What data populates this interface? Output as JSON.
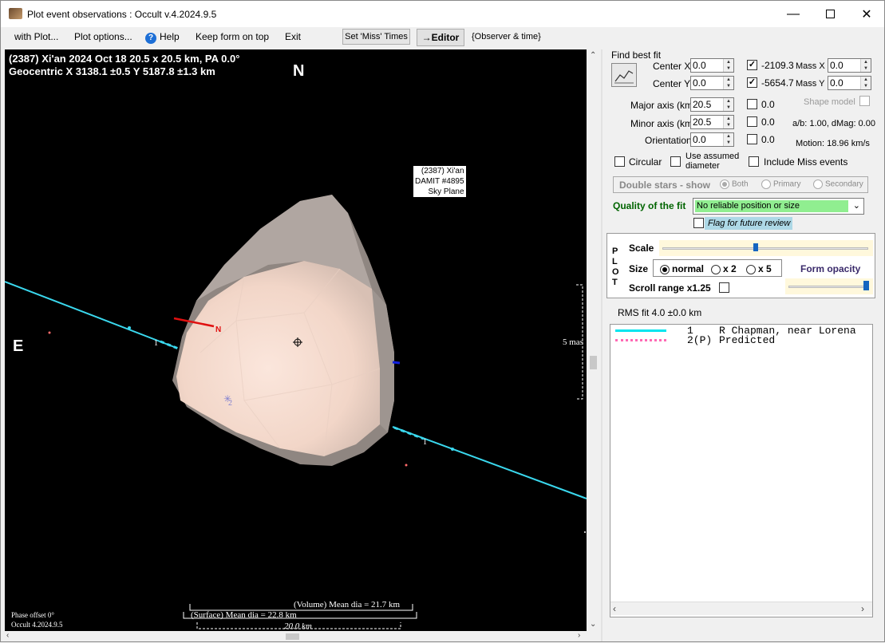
{
  "window": {
    "title": "Plot event observations : Occult v.4.2024.9.5"
  },
  "menu": {
    "with_plot": "with Plot...",
    "plot_options": "Plot options...",
    "help": "Help",
    "keep_form": "Keep form on top",
    "exit": "Exit",
    "set_miss_times": "Set 'Miss' Times",
    "editor": "→Editor",
    "observer_time": "{Observer & time}"
  },
  "plot": {
    "header_line1": "(2387) Xi'an  2024 Oct 18  20.5 x 20.5 km, PA 0.0°",
    "header_line2": "Geocentric  X  3138.1 ±0.5  Y 5187.8 ±1.3 km",
    "north": "N",
    "east": "E",
    "model_label_1": "(2387) Xi'an",
    "model_label_2": "DAMIT #4895",
    "model_label_3": "Sky Plane",
    "scale_label": "5 mas",
    "vol_dia": "(Volume) Mean dia = 21.7 km",
    "surf_dia": "(Surface) Mean dia = 22.8 km",
    "km_scale": "20.0 km",
    "phase_offset": "Phase offset 0°",
    "version": "Occult 4.2024.9.5",
    "chord_number": "1",
    "pole_label": "N",
    "predicted_number": "2"
  },
  "fit": {
    "find_best_fit": "Find best fit",
    "center_x_label": "Center X",
    "center_x": "0.0",
    "center_y_label": "Center Y",
    "center_y": "0.0",
    "x_value": "-2109.3",
    "y_value": "-5654.7",
    "mass_x_label": "Mass X",
    "mass_x": "0.0",
    "mass_y_label": "Mass Y",
    "mass_y": "0.0",
    "major_label": "Major axis (km)",
    "major": "20.5",
    "major_cb": "0.0",
    "minor_label": "Minor axis (km)",
    "minor": "20.5",
    "minor_cb": "0.0",
    "orient_label": "Orientation",
    "orient": "0.0",
    "orient_cb": "0.0",
    "shape_model": "Shape model",
    "ab_dmag": "a/b: 1.00, dMag: 0.00",
    "motion": "Motion: 18.96 km/s",
    "circular": "Circular",
    "use_assumed": "Use assumed",
    "diameter": "diameter",
    "include_miss": "Include Miss events",
    "double_stars": "Double stars - show",
    "both": "Both",
    "primary": "Primary",
    "secondary": "Secondary",
    "quality_label": "Quality of the fit",
    "quality_value": "No reliable position or size",
    "flag_review": "Flag for future review"
  },
  "plot_controls": {
    "p": "P",
    "l": "L",
    "o": "O",
    "t": "T",
    "scale": "Scale",
    "size": "Size",
    "normal": "normal",
    "x2": "x 2",
    "x5": "x 5",
    "form_opacity": "Form opacity",
    "scroll_range": "Scroll range x1.25"
  },
  "rms": "RMS fit 4.0 ±0.0 km",
  "legend": [
    {
      "num": "1",
      "text": "R Chapman, near Lorena",
      "color": "#00e5ee"
    },
    {
      "num": "2(P)",
      "text": "Predicted",
      "color": "#ff69b4"
    }
  ],
  "colors": {
    "chord": "#3ad8ee",
    "asteroid_light": "#f6dcd0",
    "asteroid_shadow": "#8f8681",
    "quality_bg": "#90ee90"
  },
  "icons": {
    "fit_button": "fit-chart-icon",
    "help": "help-icon",
    "app": "app-icon"
  }
}
